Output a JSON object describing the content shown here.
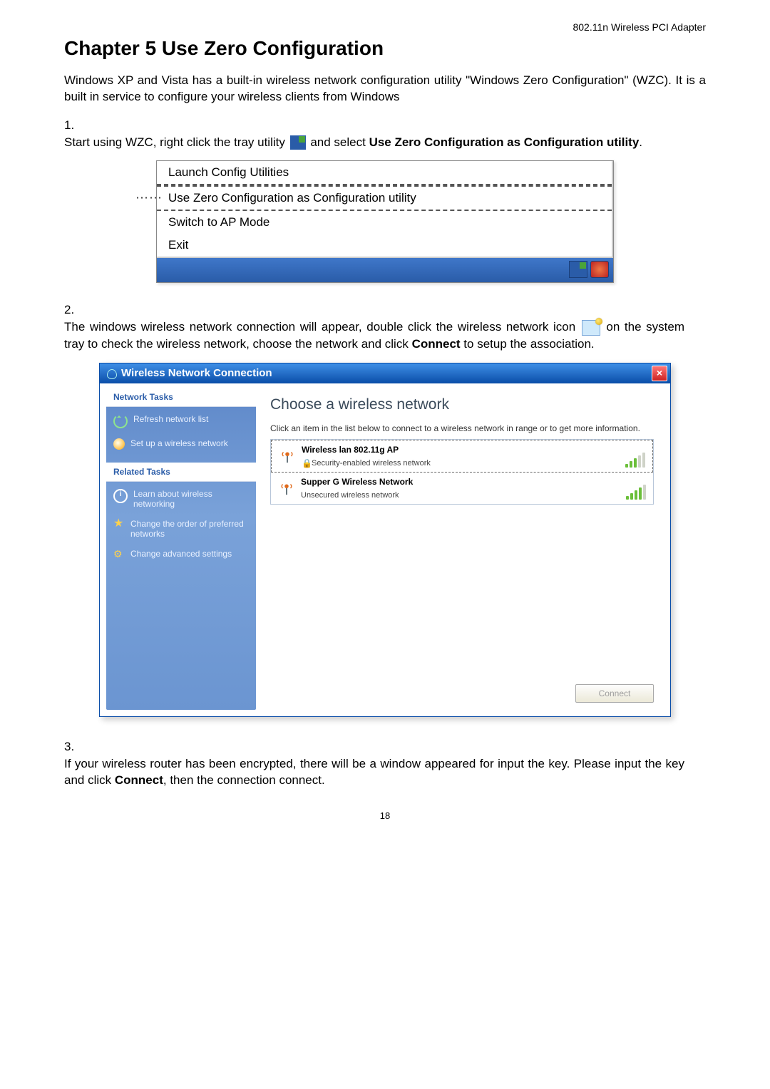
{
  "header": {
    "product": "802.11n Wireless PCI Adapter"
  },
  "chapter": {
    "title": "Chapter 5 Use Zero Configuration"
  },
  "intro": "Windows XP and Vista has a built-in wireless network configuration utility \"Windows Zero Configuration\" (WZC). It is a built in service to configure your wireless clients from Windows",
  "step1": {
    "num": "1.",
    "text_a": "Start using WZC, right click the tray utility ",
    "text_b": " and select ",
    "bold": "Use Zero Configuration as Configuration utility",
    "text_c": "."
  },
  "menu": {
    "item1": "Launch Config Utilities",
    "item2": "Use Zero Configuration as Configuration utility",
    "item3": "Switch to AP Mode",
    "item4": "Exit"
  },
  "step2": {
    "num": "2.",
    "text_a": "The windows wireless network connection will appear, double click the wireless network icon ",
    "text_b": " on the system tray to check the wireless network, choose the network and click ",
    "bold": "Connect",
    "text_c": " to setup the association."
  },
  "window": {
    "title": "Wireless Network Connection",
    "close": "×",
    "sidebar": {
      "network_tasks_title": "Network Tasks",
      "refresh": "Refresh network list",
      "setup": "Set up a wireless network",
      "related_tasks_title": "Related Tasks",
      "learn": "Learn about wireless networking",
      "order": "Change the order of preferred networks",
      "advanced": "Change advanced settings"
    },
    "main": {
      "title": "Choose a wireless network",
      "desc": "Click an item in the list below to connect to a wireless network in range or to get more information.",
      "networks": [
        {
          "name": "Wireless lan 802.11g AP",
          "sub": "Security-enabled wireless network",
          "secure": true,
          "bars_green": 3
        },
        {
          "name": "Supper G Wireless Network",
          "sub": "Unsecured wireless network",
          "secure": false,
          "bars_green": 4
        }
      ],
      "connect_label": "Connect"
    }
  },
  "step3": {
    "num": "3.",
    "text_a": "If your wireless router has been encrypted, there will be a window appeared for input the key. Please input the key and click ",
    "bold": "Connect",
    "text_b": ", then the connection connect."
  },
  "page_number": "18"
}
